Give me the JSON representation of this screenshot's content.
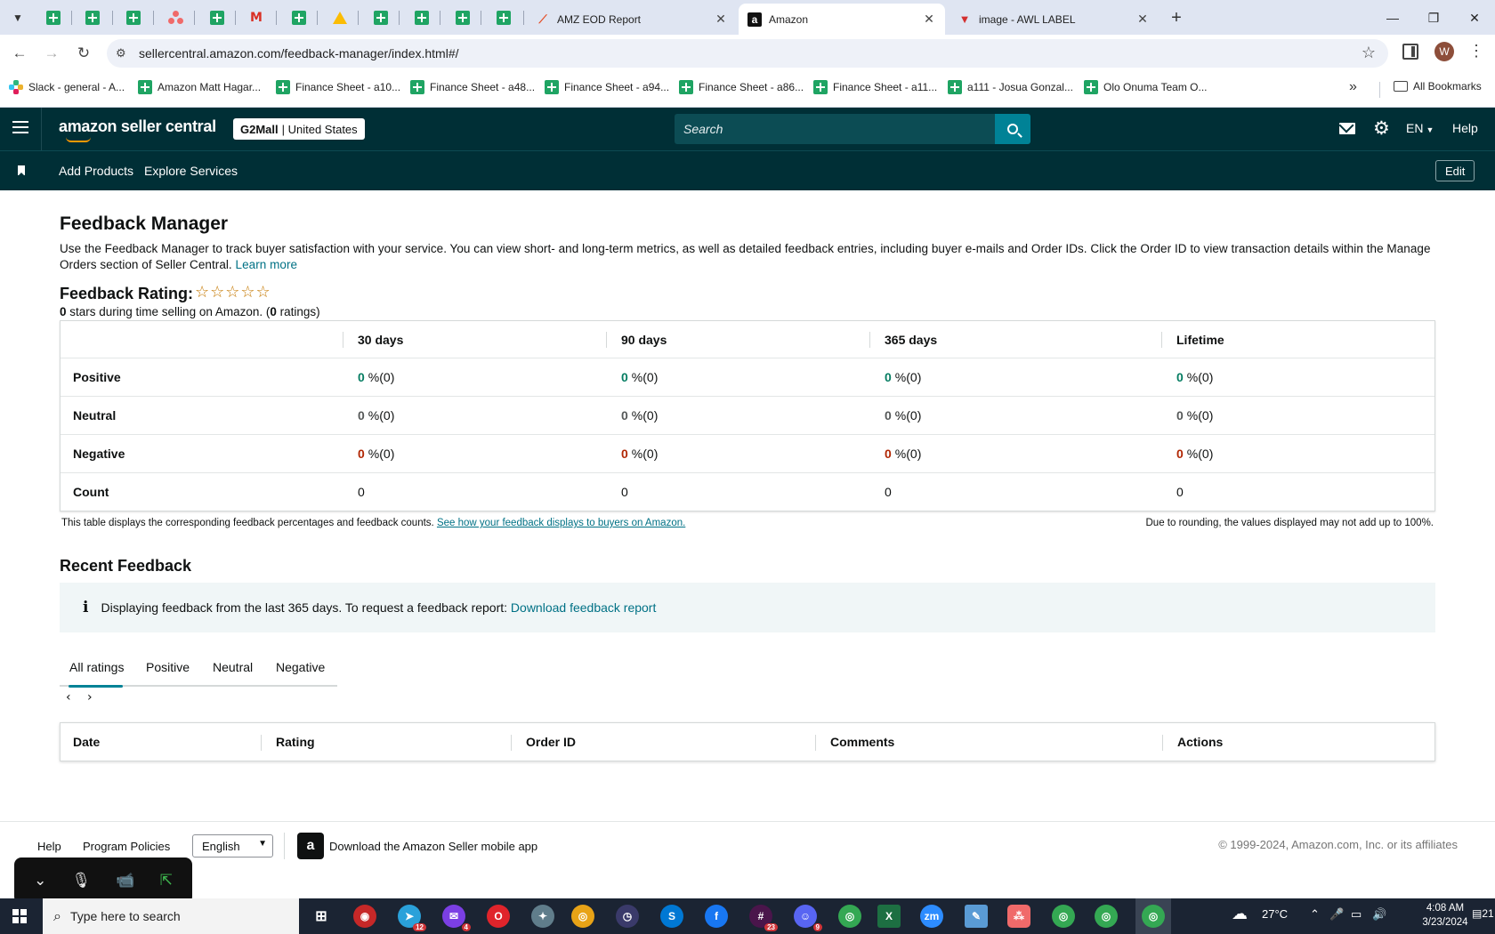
{
  "browser": {
    "tabs": [
      {
        "title": "AMZ EOD Report",
        "icon": "zoho-icon"
      },
      {
        "title": "Amazon",
        "icon": "amazon-icon",
        "active": true
      },
      {
        "title": "image - AWL LABEL",
        "icon": "vivaldi-icon"
      }
    ],
    "url": "sellercentral.amazon.com/feedback-manager/index.html#/",
    "profile_initial": "W",
    "bookmarks": [
      "Slack - general - A...",
      "Amazon Matt Hagar...",
      "Finance Sheet - a10...",
      "Finance Sheet - a48...",
      "Finance Sheet - a94...",
      "Finance Sheet - a86...",
      "Finance Sheet - a11...",
      "a111 - Josua Gonzal...",
      "Olo Onuma Team O..."
    ],
    "all_bookmarks": "All Bookmarks"
  },
  "header": {
    "logo": "amazon seller central",
    "store_name": "G2Mall",
    "store_region": "| United States",
    "search_placeholder": "Search",
    "language": "EN",
    "help": "Help"
  },
  "nav": {
    "links": [
      "Add Products",
      "Explore Services"
    ],
    "edit": "Edit"
  },
  "page": {
    "title": "Feedback Manager",
    "intro": "Use the Feedback Manager to track buyer satisfaction with your service. You can view short- and long-term metrics, as well as detailed feedback entries, including buyer e-mails and Order IDs. Click the Order ID to view transaction details within the Manage Orders section of Seller Central.",
    "learn_more": "Learn more",
    "rating_title": "Feedback Rating:",
    "stars": "☆☆☆☆☆",
    "rating_value": "0",
    "rating_sub_1": " stars during time selling on Amazon. (",
    "rating_count": "0",
    "rating_sub_2": " ratings)"
  },
  "feedback_table": {
    "columns": [
      "30 days",
      "90 days",
      "365 days",
      "Lifetime"
    ],
    "rows": [
      {
        "label": "Positive",
        "values": [
          "0",
          "0",
          "0",
          "0"
        ],
        "suffix": "%(0)"
      },
      {
        "label": "Neutral",
        "values": [
          "0",
          "0",
          "0",
          "0"
        ],
        "suffix": "%(0)"
      },
      {
        "label": "Negative",
        "values": [
          "0",
          "0",
          "0",
          "0"
        ],
        "suffix": "%(0)"
      },
      {
        "label": "Count",
        "values": [
          "0",
          "0",
          "0",
          "0"
        ]
      }
    ],
    "note": "This table displays the corresponding feedback percentages and feedback counts.",
    "note_link": "See how your feedback displays to buyers on Amazon.",
    "rounding_note": "Due to rounding, the values displayed may not add up to 100%."
  },
  "recent": {
    "title": "Recent Feedback",
    "info_icon": "i",
    "info": "Displaying feedback from the last 365 days. To request a feedback report:",
    "download_link": "Download feedback report",
    "tabs": [
      "All ratings",
      "Positive",
      "Neutral",
      "Negative"
    ],
    "columns": [
      "Date",
      "Rating",
      "Order ID",
      "Comments",
      "Actions"
    ]
  },
  "footer": {
    "help": "Help",
    "program_policies": "Program Policies",
    "language": "English",
    "app_download": "Download the Amazon Seller mobile app",
    "copyright": "© 1999-2024, Amazon.com, Inc. or its affiliates"
  },
  "taskbar": {
    "search_placeholder": "Type here to search",
    "temperature": "27°C",
    "time": "4:08 AM",
    "date": "3/23/2024",
    "notifications": "21",
    "badges": [
      "12",
      "4",
      "23",
      "9"
    ]
  },
  "colors": {
    "header_bg": "#002f36",
    "accent_teal": "#008296",
    "positive": "#067d62",
    "negative": "#b12704",
    "link": "#007185"
  }
}
